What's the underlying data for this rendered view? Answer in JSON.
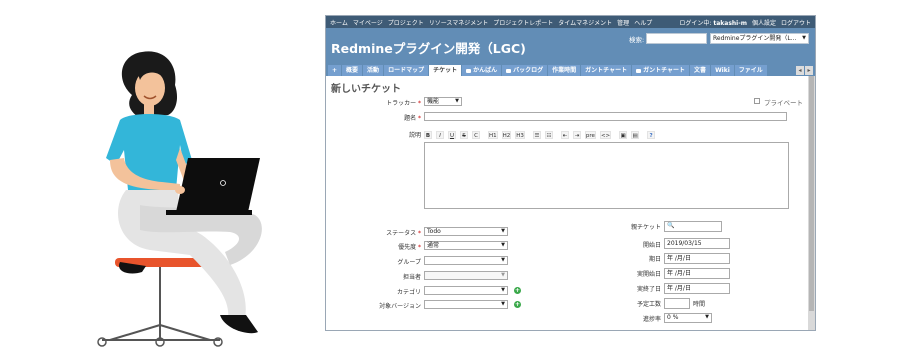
{
  "topbar": {
    "menu": [
      "ホーム",
      "マイページ",
      "プロジェクト",
      "リソースマネジメント",
      "プロジェクトレポート",
      "タイムマネジメント",
      "管理",
      "ヘルプ"
    ],
    "login_label": "ログイン中:",
    "username": "takashi-m",
    "personal_settings": "個人設定",
    "logout": "ログアウト"
  },
  "header": {
    "project_title": "Redmineプラグイン開発（LGC)",
    "search_label": "検索:",
    "project_jump_value": "Redmineプラグイン開発（L..."
  },
  "tabs": [
    {
      "label": "+",
      "icon": "",
      "active": false
    },
    {
      "label": "概要",
      "icon": "",
      "active": false
    },
    {
      "label": "活動",
      "icon": "",
      "active": false
    },
    {
      "label": "ロードマップ",
      "icon": "",
      "active": false
    },
    {
      "label": "チケット",
      "icon": "",
      "active": true
    },
    {
      "label": "かんばん",
      "icon": "board-icon",
      "active": false
    },
    {
      "label": "バックログ",
      "icon": "board-icon",
      "active": false
    },
    {
      "label": "作業時間",
      "icon": "",
      "active": false
    },
    {
      "label": "ガントチャート",
      "icon": "",
      "active": false
    },
    {
      "label": "ガントチャート",
      "icon": "board-icon",
      "active": false
    },
    {
      "label": "文書",
      "icon": "",
      "active": false
    },
    {
      "label": "Wiki",
      "icon": "",
      "active": false
    },
    {
      "label": "ファイル",
      "icon": "",
      "active": false
    }
  ],
  "tab_scroll": {
    "left": "◂",
    "right": "▸"
  },
  "page_title": "新しいチケット",
  "form": {
    "tracker_label": "トラッカー",
    "tracker_value": "機能",
    "private_label": "プライベート",
    "subject_label": "題名",
    "description_label": "説明",
    "required_mark": "*",
    "status_label": "ステータス",
    "status_value": "Todo",
    "priority_label": "優先度",
    "priority_value": "通常",
    "group_label": "グループ",
    "assignee_label": "担当者",
    "category_label": "カテゴリ",
    "version_label": "対象バージョン",
    "parent_label": "親チケット",
    "start_date_label": "開始日",
    "start_date_value": "2019/03/15",
    "due_date_label": "期日",
    "actual_start_label": "実開始日",
    "actual_end_label": "実終了日",
    "date_placeholder": "年 /月/日",
    "estimated_label": "予定工数",
    "hours_unit": "時間",
    "done_ratio_label": "進捗率",
    "done_ratio_value": "0 %"
  },
  "toolbar": [
    "B",
    "I",
    "U",
    "S",
    "C",
    "H1",
    "H2",
    "H3",
    "☰",
    "☷",
    "⇤",
    "⇥",
    "pre",
    "<>",
    "▣",
    "▤",
    "?"
  ],
  "colors": {
    "topbar": "#3e5b76",
    "header": "#628db6",
    "tab": "#759fcf",
    "required": "#cc0000",
    "shirt": "#33b6d9",
    "stool": "#e8542c"
  }
}
